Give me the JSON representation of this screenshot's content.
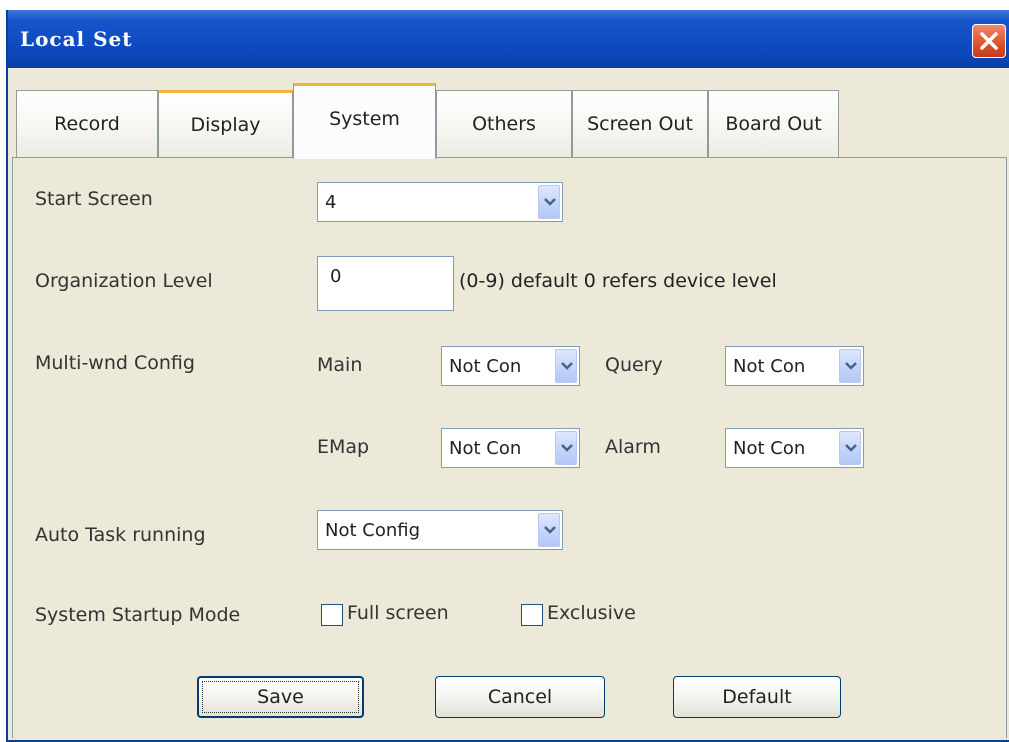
{
  "window": {
    "title": "Local Set"
  },
  "tabs": [
    {
      "label": "Record"
    },
    {
      "label": "Display"
    },
    {
      "label": "System"
    },
    {
      "label": "Others"
    },
    {
      "label": "Screen Out"
    },
    {
      "label": "Board Out"
    }
  ],
  "active_tab": "System",
  "form": {
    "start_screen": {
      "label": "Start Screen",
      "value": "4"
    },
    "organization_level": {
      "label": "Organization Level",
      "value": "0",
      "hint": "(0-9) default 0 refers device level"
    },
    "multi_wnd": {
      "label": "Multi-wnd Config",
      "main": {
        "label": "Main",
        "value": "Not Con"
      },
      "query": {
        "label": "Query",
        "value": "Not Con"
      },
      "emap": {
        "label": "EMap",
        "value": "Not Con"
      },
      "alarm": {
        "label": "Alarm",
        "value": "Not Con"
      }
    },
    "auto_task": {
      "label": "Auto Task running",
      "value": "Not Config"
    },
    "startup_mode": {
      "label": "System Startup Mode",
      "full_screen": {
        "label": "Full screen",
        "checked": false
      },
      "exclusive": {
        "label": "Exclusive",
        "checked": false
      }
    }
  },
  "buttons": {
    "save": "Save",
    "cancel": "Cancel",
    "default": "Default"
  },
  "icons": {
    "close": "close-icon",
    "dropdown": "chevron-down-icon"
  },
  "colors": {
    "titlebar": "#0b44b4",
    "dialog_bg": "#ece9d8",
    "tab_highlight": "#f1b33c",
    "close_button": "#e05a35"
  }
}
